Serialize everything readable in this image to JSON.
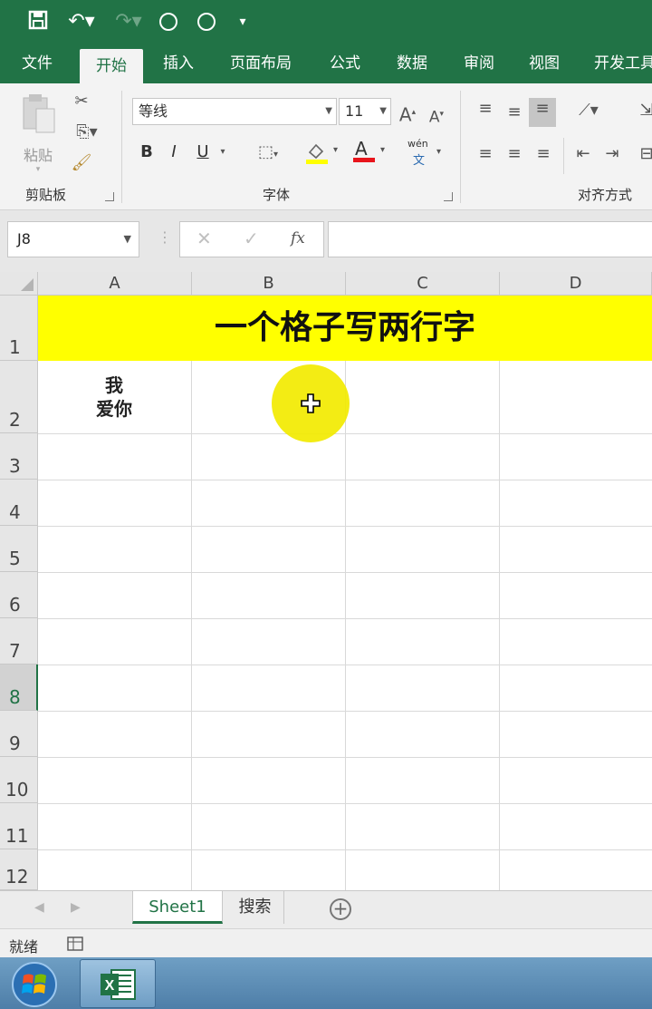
{
  "ribbon_tabs": [
    "文件",
    "开始",
    "插入",
    "页面布局",
    "公式",
    "数据",
    "审阅",
    "视图",
    "开发工具"
  ],
  "active_tab": "开始",
  "clipboard": {
    "paste_label": "粘贴",
    "group_label": "剪贴板"
  },
  "font": {
    "name": "等线",
    "size": "11",
    "group_label": "字体",
    "bold": "B",
    "italic": "I",
    "underline": "U",
    "grow": "A",
    "shrink": "A",
    "phonetic_top": "wén",
    "phonetic_bottom": "文",
    "font_color_letter": "A"
  },
  "alignment": {
    "group_label": "对齐方式"
  },
  "formula_bar": {
    "name_box": "J8",
    "fx": "fx",
    "content": ""
  },
  "columns": [
    "A",
    "B",
    "C",
    "D"
  ],
  "rows": [
    "1",
    "2",
    "3",
    "4",
    "5",
    "6",
    "7",
    "8",
    "9",
    "10",
    "11",
    "12"
  ],
  "selected_row": "8",
  "cells": {
    "row1_merged": "一个格子写两行字",
    "A2_line1": "我",
    "A2_line2": "爱你"
  },
  "sheets": {
    "active": "Sheet1",
    "other": "搜索",
    "add": "+"
  },
  "status": {
    "ready": "就绪"
  },
  "colors": {
    "excel_green": "#217346",
    "title_fill": "#ffff00"
  }
}
